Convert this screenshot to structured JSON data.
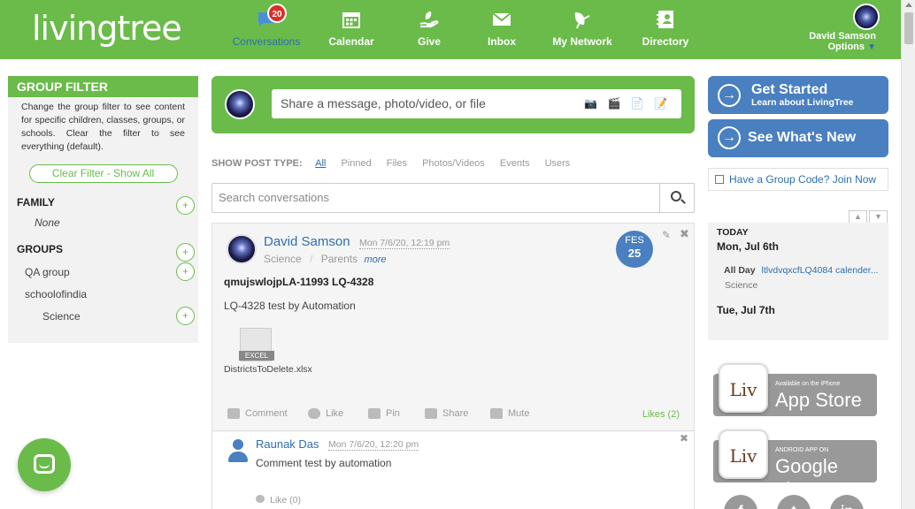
{
  "brand": {
    "logo_text": "livingtree"
  },
  "nav": {
    "items": [
      {
        "label": "Conversations",
        "icon": "chat-icon",
        "active": true,
        "badge": "20"
      },
      {
        "label": "Calendar",
        "icon": "calendar-icon"
      },
      {
        "label": "Give",
        "icon": "hand-leaf-icon"
      },
      {
        "label": "Inbox",
        "icon": "envelope-icon"
      },
      {
        "label": "My Network",
        "icon": "network-leaf-icon"
      },
      {
        "label": "Directory",
        "icon": "directory-icon"
      }
    ],
    "user_name": "David Samson",
    "options_label": "Options",
    "options_arrow": "▼"
  },
  "filter": {
    "title": "GROUP FILTER",
    "description": "Change the group filter to see content for specific children, classes, groups, or schools. Clear the filter to see everything (default).",
    "clear_label": "Clear Filter - Show All",
    "family_title": "FAMILY",
    "family_none": "None",
    "groups_title": "GROUPS",
    "groups": [
      "QA group",
      "schoolofindia",
      "Science"
    ],
    "plus": "+"
  },
  "composer": {
    "placeholder": "Share a message, photo/video, or file",
    "icons": "📷 🎬 📄 📝"
  },
  "post_types": {
    "label": "SHOW POST TYPE:",
    "types": [
      "All",
      "Pinned",
      "Files",
      "Photos/Videos",
      "Events",
      "Users"
    ]
  },
  "search": {
    "placeholder": "Search conversations"
  },
  "post": {
    "author": "David Samson",
    "time": "Mon 7/6/20, 12:19 pm",
    "group1": "Science",
    "sep": "/",
    "group2": "Parents",
    "more": "more",
    "date_month": "FES",
    "date_day": "25",
    "edit": "✎",
    "close": "✖",
    "title": "qmujswlojpLA-11993 LQ-4328",
    "body": "LQ-4328 test by Automation",
    "file_name": "DistrictsToDelete.xlsx",
    "file_type": "EXCEL",
    "actions": [
      "Comment",
      "Like",
      "Pin",
      "Share",
      "Mute"
    ],
    "likes": "Likes (2)"
  },
  "comment": {
    "author": "Raunak Das",
    "time": "Mon 7/6/20, 12:20 pm",
    "body": "Comment test by automation",
    "like": "Like (0)",
    "close": "✖"
  },
  "right": {
    "get_started": "Get Started",
    "get_started_sub": "Learn about LivingTree",
    "whats_new": "See What's New",
    "arrow": "→",
    "group_code": "Have a Group Code? Join Now",
    "cal_up": "▲",
    "cal_down": "▼",
    "today_label": "TODAY",
    "day1": "Mon, Jul 6th",
    "event_allday": "All Day",
    "event_title": "ltlvdvqxcfLQ4084 calender...",
    "event_group": "Science",
    "day2": "Tue, Jul 7th",
    "appstore_small": "Available on the iPhone",
    "appstore_big": "App Store",
    "google_small": "ANDROID APP ON",
    "google_big": "Google play",
    "liv": "Liv",
    "social": [
      "f",
      "t",
      "in"
    ]
  },
  "colors": {
    "brand_green": "#6abb4a",
    "link_blue": "#2c6fb0",
    "button_blue": "#4a7fc0",
    "badge_red": "#d93025"
  }
}
